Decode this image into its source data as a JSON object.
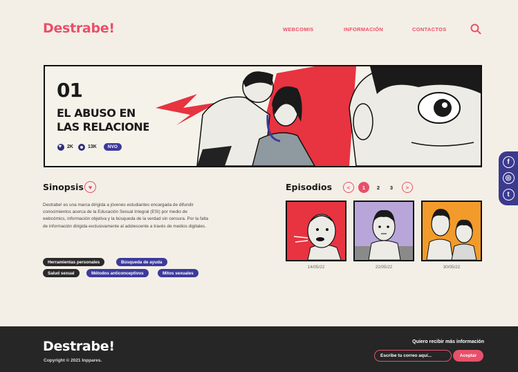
{
  "header": {
    "logo": "Destrabe!",
    "nav": [
      "WEBCOMIS",
      "INFORMACIÓN",
      "CONTACTOS"
    ],
    "search_icon": "search-icon"
  },
  "hero": {
    "number": "01",
    "title_line1": "EL ABUSO EN",
    "title_line2": "LAS RELACIONES",
    "likes": "2K",
    "views": "13K",
    "badge": "NVO"
  },
  "social": [
    "f",
    "◎",
    "t"
  ],
  "sinopsis": {
    "title": "Sinopsis",
    "text": "Destrabe! es una marca dirigida a jóvenes estudiantes encargada de difundir conocimientos acerca de la Educación Sexual Integral (ESI) por medio de webcómics, información objetiva y la búsqueda de la verdad sin censura. Por la falta de información dirigida exclusivamente al adolescente a través de medios digitales.",
    "tags": [
      "Herramientas personales",
      "Búsqueda de ayuda",
      "Salud sexual",
      "Métodos anticonceptivos",
      "Mitos sexuales"
    ]
  },
  "episodios": {
    "title": "Episodios",
    "prev": "<",
    "pages": [
      "1",
      "2",
      "3"
    ],
    "next": ">",
    "dates": [
      "14/05/22",
      "22/05/22",
      "30/05/22"
    ]
  },
  "footer": {
    "logo": "Destrabe!",
    "copyright": "Copyright © 2021 Inppares.",
    "newsletter_label": "Quiero recibir más información",
    "email_placeholder": "Escribe tu correo aquí...",
    "submit": "Aceptar"
  },
  "colors": {
    "accent": "#e8506a",
    "indigo": "#3d3a9c",
    "background": "#f4efe6",
    "footer": "#262626"
  }
}
